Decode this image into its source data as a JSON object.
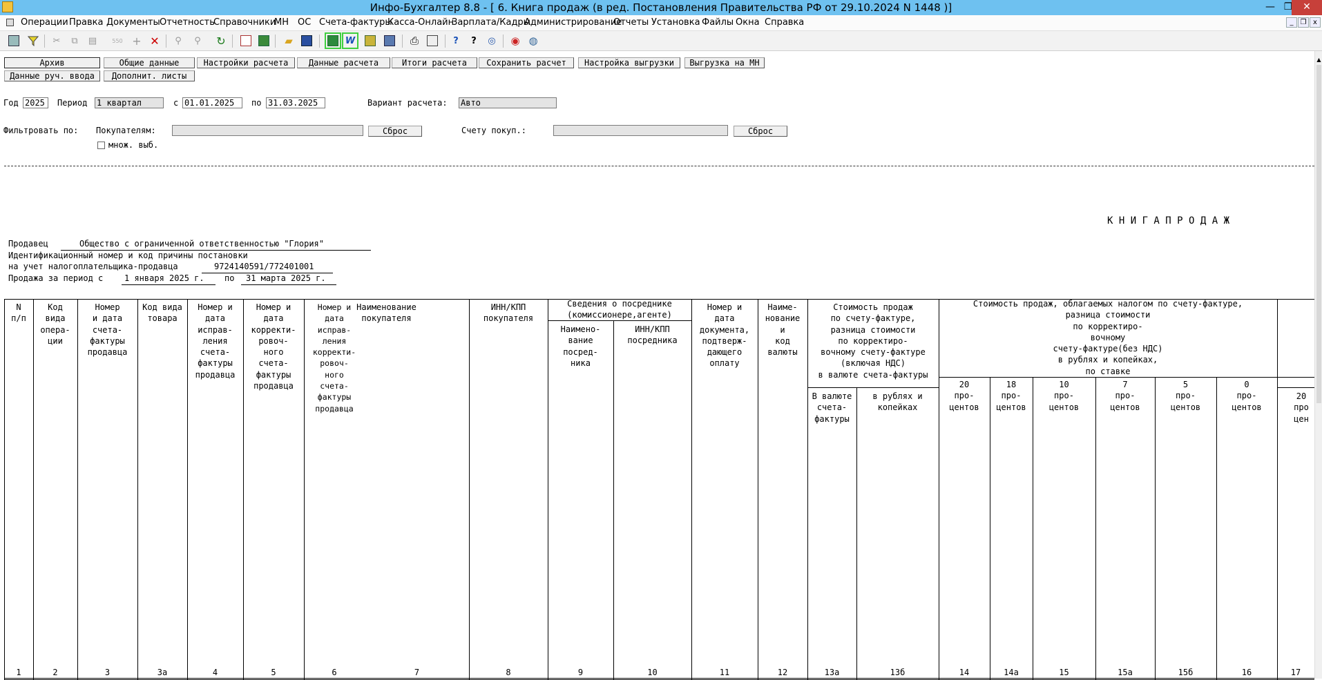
{
  "window": {
    "title": "Инфо-Бухгалтер 8.8 - [  6. Книга продаж (в ред. Постановления Правительства РФ от 29.10.2024 N 1448 )]",
    "minimize": "—",
    "restore": "❐",
    "close": "✕"
  },
  "menu": [
    "Операции",
    "Правка",
    "Документы",
    "Отчетность",
    "Справочники",
    "МН",
    "ОС",
    "Счета-фактуры",
    "Касса-Онлайн",
    "Зарплата/Кадры",
    "Администрирование",
    "Отчеты",
    "Установка",
    "Файлы",
    "Окна",
    "Справка"
  ],
  "mdi_controls": {
    "minimize": "_",
    "restore": "❐",
    "close": "x"
  },
  "top_buttons_row1": [
    "Архив",
    "Общие данные",
    "Настройки расчета",
    "Данные расчета",
    "Итоги расчета",
    "Сохранить расчет",
    "Настройка выгрузки",
    "Выгрузка на МН"
  ],
  "top_buttons_row2": [
    "Данные руч. ввода",
    "Дополнит. листы"
  ],
  "params": {
    "year_label": "Год",
    "year": "2025",
    "period_label": "Период",
    "period": "1 квартал",
    "from_label": "с",
    "from": "01.01.2025",
    "to_label": "по",
    "to": "31.03.2025",
    "variant_label": "Вариант расчета:",
    "variant": "Авто"
  },
  "filter": {
    "label": "Фильтровать по:",
    "buyers_label": "Покупателям:",
    "buyers_value": "",
    "reset1": "Сброс",
    "account_label": "Счету покуп.:",
    "account_value": "",
    "reset2": "Сброс",
    "multi_label": "множ. выб."
  },
  "report": {
    "title": "К Н И Г А   П Р О Д А Ж",
    "seller_label": "Продавец",
    "seller_value": "Общество с ограниченной ответственностью \"Глория\"",
    "inn_label_1": "Идентификационный номер и код причины постановки",
    "inn_label_2": "на учет налогоплательщика-продавца",
    "inn_value": "9724140591/772401001",
    "period_label": "Продажа за период с",
    "period_from": "1 января 2025 г.",
    "period_to_label": "по",
    "period_to": "31 марта 2025 г."
  },
  "table": {
    "h1": "N\nп/п",
    "h2": "Код\nвида\nопера-\nции",
    "h3": "Номер\nи дата\nсчета-\nфактуры\nпродавца",
    "h3a": "Код вида\nтовара",
    "h4": "Номер и\nдата\nисправ-\nления\nсчета-\nфактуры\nпродавца",
    "h5": "Номер и\nдата\nкорректи-\nровоч-\nного\nсчета-\nфактуры\nпродавца",
    "h6": "Номер и\nдата\nисправ-\nления\nкорректи-\nровоч-\nного\nсчета-\nфактуры\nпродавца",
    "h7": "Наименование\nпокупателя",
    "h8": "ИНН/КПП\nпокупателя",
    "h9_10_group": "Сведения о посреднике\n(комиссионере,агенте)",
    "h9": "Наимено-\nвание\nпосред-\nника",
    "h10": "ИНН/КПП\nпосредника",
    "h11": "Номер и\nдата\nдокумента,\nподтверж-\nдающего\nоплату",
    "h12": "Наиме-\nнование\nи\nкод\nвалюты",
    "h13_group": "Стоимость продаж\nпо счету-фактуре,\nразница стоимости\nпо корректиро-\nвочному счету-фактуре\n(включая НДС)\nв валюте счета-фактуры",
    "h13a": "В валюте\nсчета-\nфактуры",
    "h13b": "в рублях и\nкопейках",
    "h14_group": "Стоимость продаж, облагаемых налогом по счету-фактуре,\nразница стоимости\nпо корректиро-\nвочному\nсчету-фактуре(без НДС)\nв рублях и копейках,\nпо ставке",
    "rates": [
      "20\nпро-\nцентов",
      "18\nпро-\nцентов",
      "10\nпро-\nцентов",
      "7\nпро-\nцентов",
      "5\nпро-\nцентов",
      "0\nпро-\nцентов"
    ],
    "rate_last": "20\nпро\nцен",
    "col_numbers": [
      "1",
      "2",
      "3",
      "3а",
      "4",
      "5",
      "6",
      "7",
      "8",
      "9",
      "10",
      "11",
      "12",
      "13а",
      "13б",
      "14",
      "14а",
      "15",
      "15а",
      "15б",
      "16",
      "17"
    ]
  }
}
